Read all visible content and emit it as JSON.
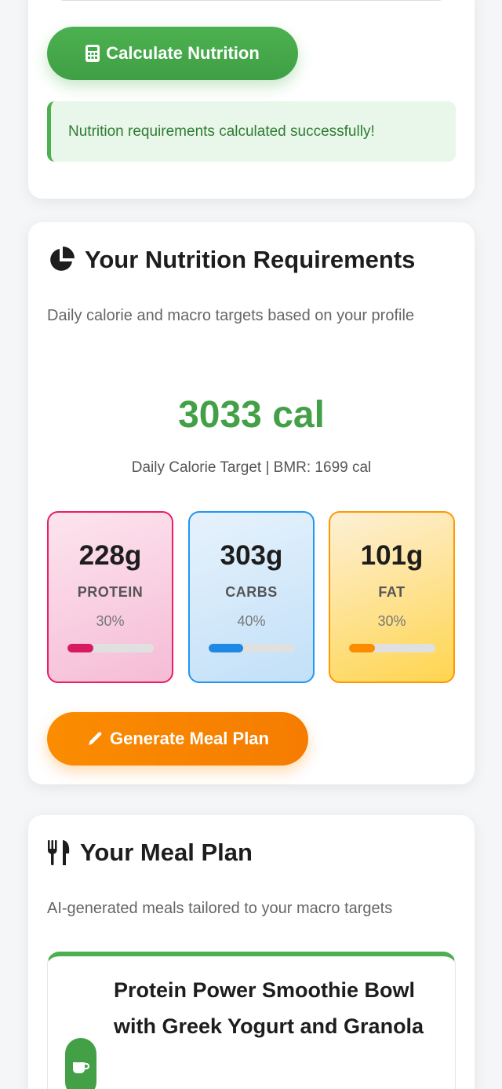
{
  "calculator": {
    "button_label": "Calculate Nutrition",
    "success_message": "Nutrition requirements calculated successfully!"
  },
  "requirements": {
    "title": "Your Nutrition Requirements",
    "description": "Daily calorie and macro targets based on your profile",
    "calories": "3033 cal",
    "calorie_subtitle": "Daily Calorie Target | BMR: 1699 cal",
    "macros": [
      {
        "grams": "228g",
        "label": "PROTEIN",
        "percent": "30%",
        "progress": 0.3,
        "color": "#e91e63"
      },
      {
        "grams": "303g",
        "label": "CARBS",
        "percent": "40%",
        "progress": 0.4,
        "color": "#2196f3"
      },
      {
        "grams": "101g",
        "label": "FAT",
        "percent": "30%",
        "progress": 0.3,
        "color": "#ff9800"
      }
    ],
    "generate_button_label": "Generate Meal Plan"
  },
  "meal_plan": {
    "title": "Your Meal Plan",
    "description": "AI-generated meals tailored to your macro targets",
    "meals": [
      {
        "name": "Protein Power Smoothie Bowl with Greek Yogurt and Granola",
        "icon": "coffee-cup-icon"
      }
    ]
  },
  "colors": {
    "primary_green": "#4caf50",
    "accent_orange": "#fb8c00",
    "calorie_green": "#43a047"
  },
  "icons": {
    "calculate": "calculator-icon",
    "requirements": "pie-chart-icon",
    "generate": "pencil-icon",
    "meal_plan": "utensils-icon"
  }
}
